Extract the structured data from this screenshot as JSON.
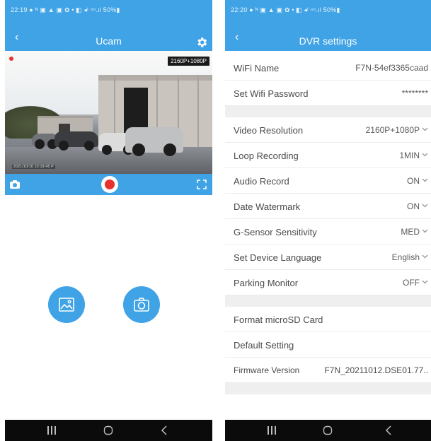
{
  "colors": {
    "accent": "#3fa3e6",
    "record": "#e8322f",
    "navbar": "#0b0b0b"
  },
  "left": {
    "status": {
      "time": "22:19",
      "icons_left": "● ᴺ ▣ ▲ ▣ ✿ •",
      "icons_right": "◧ ◂ᴵ ⁴⁶.ıl 50%▮"
    },
    "title": "Ucam",
    "back_icon": "back-arrow-icon",
    "settings_icon": "gear-icon",
    "preview": {
      "resolution_badge": "2160P+1080P",
      "timestamp": "2021/10/16 10:19:45 P"
    },
    "controls": {
      "snapshot_icon": "camera-icon",
      "record_icon": "record-icon",
      "fullscreen_icon": "fullscreen-icon"
    },
    "actions": [
      {
        "name": "gallery",
        "icon": "image-icon"
      },
      {
        "name": "snapshot",
        "icon": "camera-icon"
      }
    ],
    "nav": {
      "recents": "recents-icon",
      "home": "home-icon",
      "back": "back-icon"
    }
  },
  "right": {
    "status": {
      "time": "22:20",
      "icons_left": "● ᴺ ▣ ▲ ▣ ✿ •",
      "icons_right": "◧ ◂ᴵ ⁴⁶.ıl 50%▮"
    },
    "title": "DVR settings",
    "rows": [
      {
        "label": "WiFi Name",
        "value": "F7N-54ef3365caad"
      },
      {
        "label": "Set Wifi Password",
        "value": "********"
      },
      {
        "label": "Video Resolution",
        "value": "2160P+1080P"
      },
      {
        "label": "Loop Recording",
        "value": "1MIN"
      },
      {
        "label": "Audio Record",
        "value": "ON"
      },
      {
        "label": "Date Watermark",
        "value": "ON"
      },
      {
        "label": "G-Sensor Sensitivity",
        "value": "MED"
      },
      {
        "label": "Set Device Language",
        "value": "English"
      },
      {
        "label": "Parking Monitor",
        "value": "OFF"
      },
      {
        "label": "Format microSD Card",
        "value": ""
      },
      {
        "label": "Default Setting",
        "value": ""
      },
      {
        "label": "Firmware Version",
        "value": "F7N_20211012.DSE01.77.."
      }
    ]
  }
}
